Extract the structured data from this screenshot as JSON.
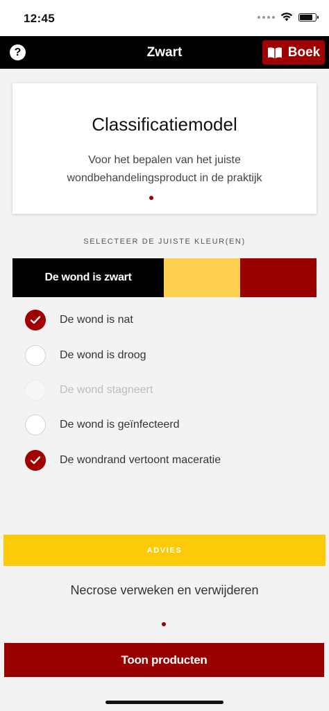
{
  "status_bar": {
    "time": "12:45",
    "icons": [
      "signal-icon",
      "wifi-icon",
      "battery-icon"
    ]
  },
  "nav": {
    "help_symbol": "?",
    "title": "Zwart",
    "book_label": "Boek",
    "icons": [
      "help-icon",
      "book-icon"
    ]
  },
  "intro": {
    "title": "Classificatiemodel",
    "text": "Voor het bepalen van het juiste wondbehandelingsproduct in de praktijk"
  },
  "selector": {
    "label": "SELECTEER DE JUISTE KLEUR(EN)",
    "colors": [
      {
        "label": "De wond is zwart",
        "color": "#000000",
        "selected": true
      },
      {
        "label": "",
        "color": "#fdd050",
        "selected": false
      },
      {
        "label": "",
        "color": "#990000",
        "selected": false
      }
    ]
  },
  "options": [
    {
      "label": "De wond is nat",
      "state": "checked"
    },
    {
      "label": "De wond is droog",
      "state": "unchecked"
    },
    {
      "label": "De wond stagneert",
      "state": "disabled"
    },
    {
      "label": "De wond is geïnfecteerd",
      "state": "unchecked"
    },
    {
      "label": "De wondrand vertoont maceratie",
      "state": "checked"
    }
  ],
  "advice": {
    "header": "ADVIES",
    "text": "Necrose verweken en verwijderen"
  },
  "products_button": "Toon producten",
  "colors": {
    "accent_red": "#a00000",
    "advice_yellow": "#fccb08",
    "nav_black": "#000000"
  }
}
